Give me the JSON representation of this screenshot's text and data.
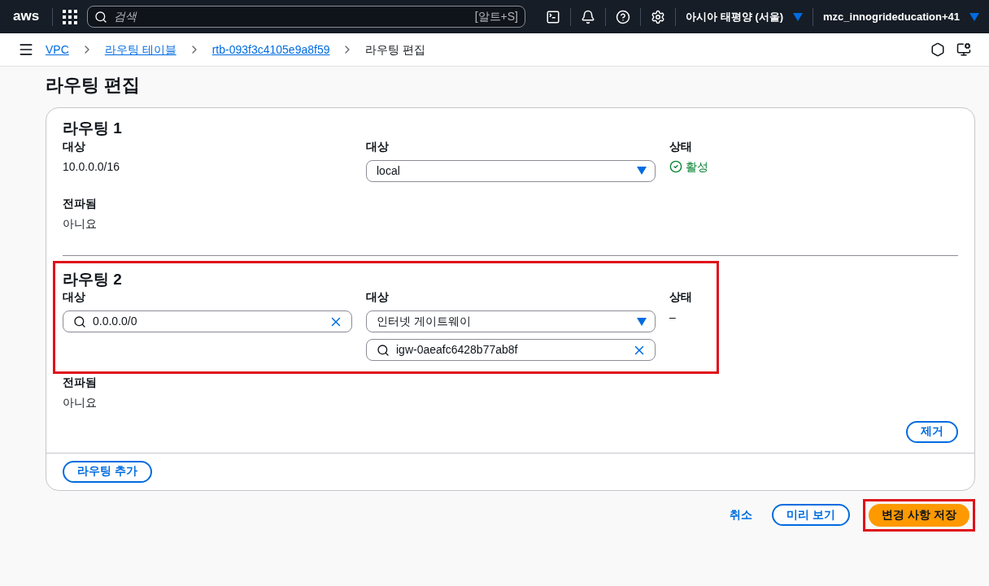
{
  "topbar": {
    "logo": "aws",
    "search_placeholder": "검색",
    "search_shortcut": "[알트+S]",
    "region": "아시아 태평양 (서울)",
    "account": "mzc_innogrideducation+41"
  },
  "breadcrumbs": [
    {
      "label": "VPC",
      "link": true
    },
    {
      "label": "라우팅 테이블",
      "link": true
    },
    {
      "label": "rtb-093f3c4105e9a8f59",
      "link": true
    },
    {
      "label": "라우팅 편집",
      "link": false
    }
  ],
  "page_title": "라우팅 편집",
  "routes": [
    {
      "title": "라우팅 1",
      "highlighted": false,
      "destination_label": "대상",
      "destination": {
        "kind": "text",
        "value": "10.0.0.0/16"
      },
      "target_label": "대상",
      "target_select": "local",
      "status_label": "상태",
      "status": {
        "kind": "active",
        "text": "활성"
      },
      "propagated_label": "전파됨",
      "propagated_value": "아니요"
    },
    {
      "title": "라우팅 2",
      "highlighted": true,
      "destination_label": "대상",
      "destination": {
        "kind": "search",
        "value": "0.0.0.0/0"
      },
      "target_label": "대상",
      "target_select": "인터넷 게이트웨이",
      "target_search": "igw-0aeafc6428b77ab8f",
      "status_label": "상태",
      "status": {
        "kind": "none",
        "text": "–"
      },
      "propagated_label": "전파됨",
      "propagated_value": "아니요",
      "remove_button": "제거"
    }
  ],
  "add_route_button": "라우팅 추가",
  "footer": {
    "cancel": "취소",
    "preview": "미리 보기",
    "save": "변경 사항 저장",
    "save_highlighted": true
  }
}
